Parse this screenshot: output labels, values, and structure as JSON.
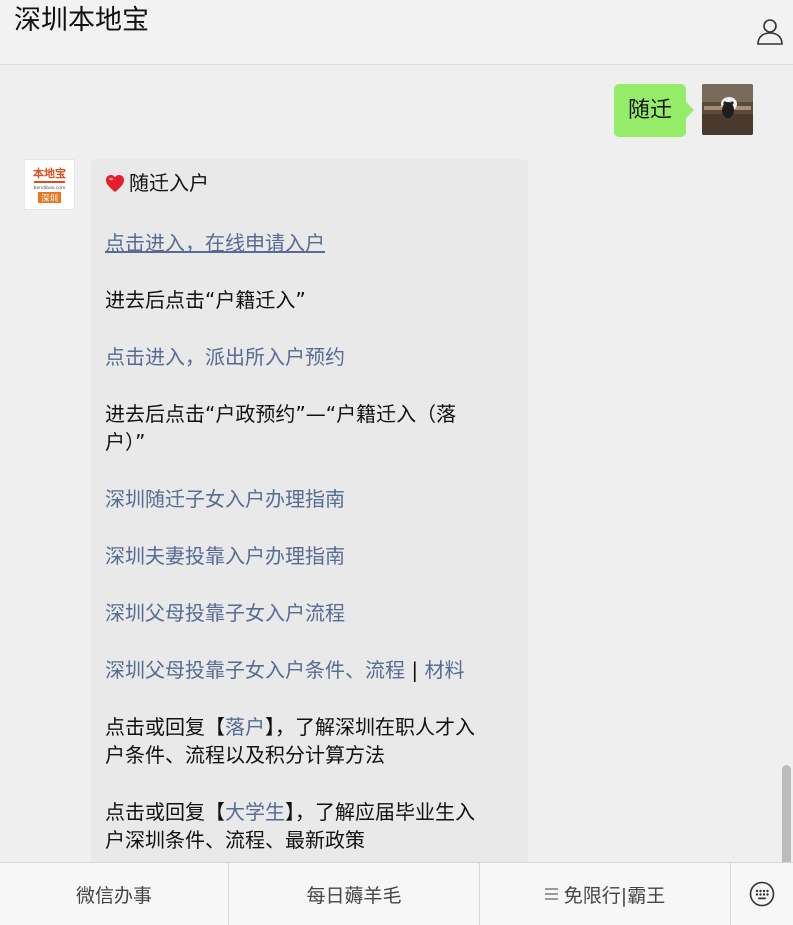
{
  "header": {
    "title": "深圳本地宝",
    "user_icon": "person-outline-icon"
  },
  "outgoing": {
    "text": "随迁"
  },
  "incoming": {
    "avatar_logo_text": "本地宝",
    "avatar_logo_sub": "bendibao.com",
    "avatar_city": "深圳",
    "heart_icon": "red-heart-icon",
    "heading": "随迁入户",
    "link_apply": "点击进入，在线申请入户",
    "text_after_apply": "进去后点击“户籍迁入”",
    "link_appointment": "点击进入，派出所入户预约",
    "text_after_appointment_1": "进去后点击“户政预约”—“户籍迁入（落",
    "text_after_appointment_2": "户）”",
    "link_children": "深圳随迁子女入户办理指南",
    "link_spouse": "深圳夫妻投靠入户办理指南",
    "link_parents": "深圳父母投靠子女入户流程",
    "link_parents_conditions": "深圳父母投靠子女入户条件、流程",
    "separator": "|",
    "link_materials": "材料",
    "reply_prefix": "点击或回复【",
    "reply_luohu_keyword": "落户",
    "reply_luohu_suffix_1": "】，了解深圳在职人才入",
    "reply_luohu_suffix_2": "户条件、流程以及积分计算方法",
    "reply_daxuesheng_keyword": "大学生",
    "reply_daxuesheng_suffix_1": "】，了解应届毕业生入",
    "reply_daxuesheng_suffix_2": "户深圳条件、流程、最新政策"
  },
  "bottom_menu": {
    "item1": "微信办事",
    "item2": "每日薅羊毛",
    "item3": "免限行|霸王",
    "keyboard_icon": "keyboard-icon"
  },
  "colors": {
    "link": "#576b95",
    "outgoing_bubble": "#95ec69",
    "incoming_bubble": "#e9e9e9"
  }
}
